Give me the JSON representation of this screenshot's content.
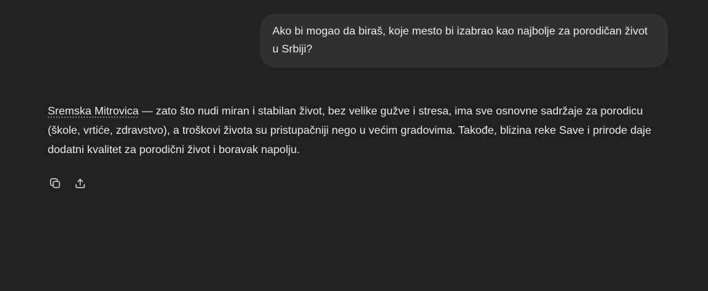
{
  "user_message": {
    "text": "Ako bi mogao da biraš, koje mesto bi izabrao kao najbolje za porodičan život u Srbiji?"
  },
  "assistant_message": {
    "entity": "Sremska Mitrovica",
    "text": " — zato što nudi miran i stabilan život, bez velike gužve i stresa, ima sve osnovne sadržaje za porodicu (škole, vrtiće, zdravstvo), a troškovi života su pristupačniji nego u većim gradovima. Takođe, blizina reke Save i prirode daje dodatni kvalitet za porodični život i boravak napolju."
  },
  "actions": {
    "copy_icon": "copy-icon",
    "share_icon": "share-icon"
  },
  "colors": {
    "background": "#212121",
    "bubble": "#303030",
    "text": "#ececec"
  }
}
